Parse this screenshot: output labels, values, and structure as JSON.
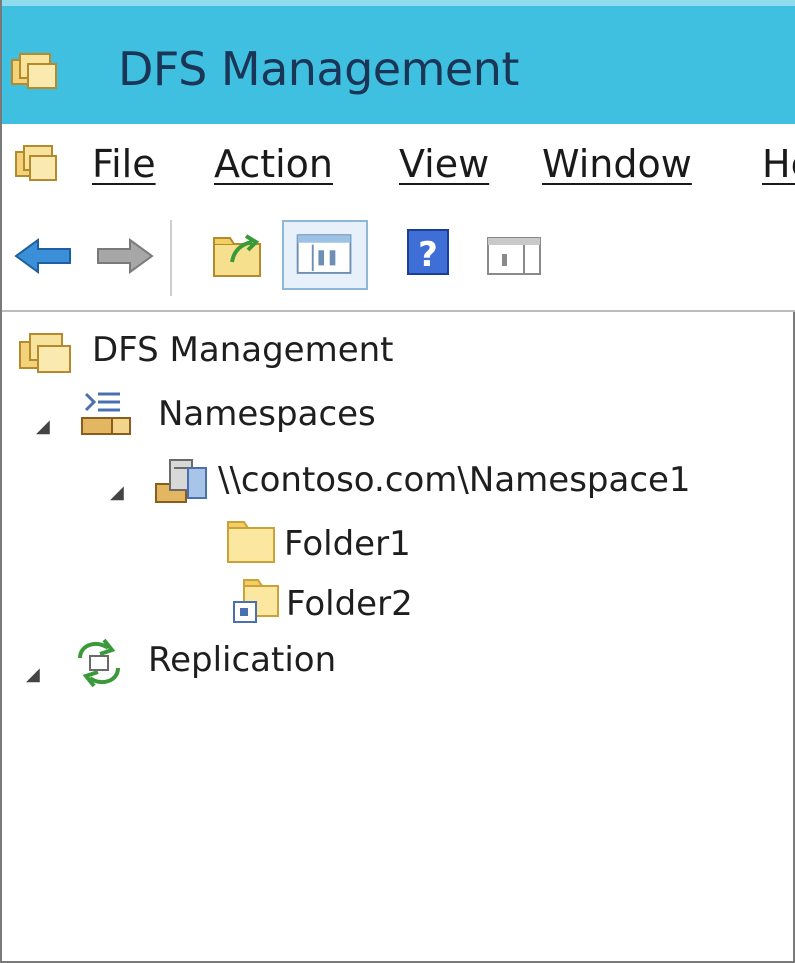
{
  "window": {
    "title": "DFS Management"
  },
  "menu": {
    "file": "File",
    "action": "Action",
    "view": "View",
    "window": "Window",
    "help": "Help"
  },
  "toolbar": {
    "back": "back-arrow-icon",
    "forward": "forward-arrow-icon",
    "up": "up-folder-icon",
    "show_hide": "show-hide-console-tree-icon",
    "help": "help-icon",
    "action_pane": "show-action-pane-icon"
  },
  "tree": {
    "root": {
      "label": "DFS Management",
      "icon": "dfs-management-icon"
    },
    "namespaces": {
      "label": "Namespaces",
      "icon": "namespaces-icon",
      "expander": "◢"
    },
    "namespace1": {
      "label": "\\\\contoso.com\\Namespace1",
      "icon": "namespace-server-icon",
      "expander": "◢"
    },
    "folder1": {
      "label": "Folder1",
      "icon": "folder-icon"
    },
    "folder2": {
      "label": "Folder2",
      "icon": "folder-with-targets-icon"
    },
    "replication": {
      "label": "Replication",
      "icon": "replication-icon",
      "expander": "◢"
    }
  },
  "colors": {
    "titlebar": "#3fc0e0",
    "title_text": "#1b3556",
    "toolbar_highlight": "#e8f1fa"
  }
}
